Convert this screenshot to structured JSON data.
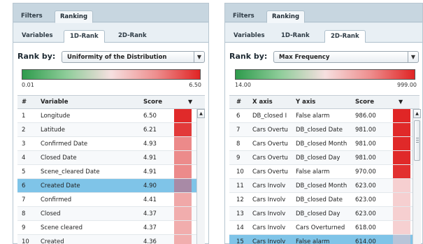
{
  "left_panel": {
    "tabs": [
      "Filters",
      "Ranking"
    ],
    "subtabs": [
      "Variables",
      "1D-Rank",
      "2D-Rank"
    ],
    "rank_by_label": "Rank by:",
    "rank_by_value": "Uniformity of the Distribution",
    "gradient_min": "0.01",
    "gradient_max": "6.50",
    "columns": [
      "#",
      "Variable",
      "Score"
    ],
    "rows": [
      {
        "num": "1",
        "variable": "Longitude",
        "score": "6.50",
        "color": "#e02a2a"
      },
      {
        "num": "2",
        "variable": "Latitude",
        "score": "6.21",
        "color": "#e23a3a"
      },
      {
        "num": "3",
        "variable": "Confirmed Date",
        "score": "4.93",
        "color": "#ec8a8a"
      },
      {
        "num": "4",
        "variable": "Closed Date",
        "score": "4.91",
        "color": "#ec8b8b"
      },
      {
        "num": "5",
        "variable": "Scene_cleared Date",
        "score": "4.91",
        "color": "#ec8b8b"
      },
      {
        "num": "6",
        "variable": "Created Date",
        "score": "4.90",
        "color": "#a88aa6"
      },
      {
        "num": "7",
        "variable": "Confirmed",
        "score": "4.41",
        "color": "#f0a8a8"
      },
      {
        "num": "8",
        "variable": "Closed",
        "score": "4.37",
        "color": "#f1adad"
      },
      {
        "num": "9",
        "variable": "Scene cleared",
        "score": "4.37",
        "color": "#f1adad"
      },
      {
        "num": "10",
        "variable": "Created",
        "score": "4.36",
        "color": "#f1aeae"
      }
    ],
    "selected_row": 5
  },
  "right_panel": {
    "tabs": [
      "Filters",
      "Ranking"
    ],
    "subtabs": [
      "Variables",
      "1D-Rank",
      "2D-Rank"
    ],
    "rank_by_label": "Rank by:",
    "rank_by_value": "Max Frequency",
    "gradient_min": "14.00",
    "gradient_max": "999.00",
    "columns": [
      "#",
      "X axis",
      "Y axis",
      "Score"
    ],
    "rows": [
      {
        "num": "6",
        "x": "DB_closed I",
        "y": "False alarm",
        "score": "986.00",
        "color": "#e02626"
      },
      {
        "num": "7",
        "x": "Cars Overtu",
        "y": "DB_closed Date",
        "score": "981.00",
        "color": "#e02929"
      },
      {
        "num": "8",
        "x": "Cars Overtu",
        "y": "DB_closed Month",
        "score": "981.00",
        "color": "#e02929"
      },
      {
        "num": "9",
        "x": "Cars Overtu",
        "y": "DB_closed Day",
        "score": "981.00",
        "color": "#e02929"
      },
      {
        "num": "10",
        "x": "Cars Overtu",
        "y": "False alarm",
        "score": "970.00",
        "color": "#e23030"
      },
      {
        "num": "11",
        "x": "Cars Involv",
        "y": "DB_closed Month",
        "score": "623.00",
        "color": "#f6cfd0"
      },
      {
        "num": "12",
        "x": "Cars Involv",
        "y": "DB_closed Date",
        "score": "623.00",
        "color": "#f6cfd0"
      },
      {
        "num": "13",
        "x": "Cars Involv",
        "y": "DB_closed Day",
        "score": "623.00",
        "color": "#f6cfd0"
      },
      {
        "num": "14",
        "x": "Cars Involv",
        "y": "Cars Overturned",
        "score": "618.00",
        "color": "#f6d0d1"
      },
      {
        "num": "15",
        "x": "Cars Involv",
        "y": "False alarm",
        "score": "614.00",
        "color": "#b8c4d8"
      }
    ],
    "selected_row": 9
  }
}
